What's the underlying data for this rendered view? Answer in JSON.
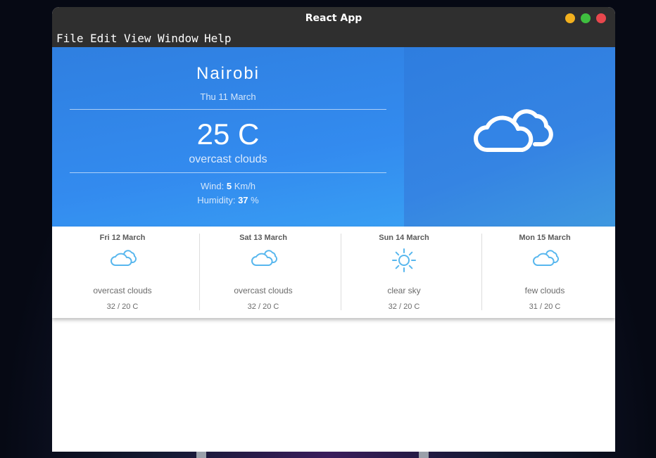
{
  "window": {
    "title": "React App"
  },
  "menu": [
    "File",
    "Edit",
    "View",
    "Window",
    "Help"
  ],
  "current": {
    "city": "Nairobi",
    "date": "Thu 11 March",
    "temp": "25 C",
    "description": "overcast clouds",
    "wind_label": "Wind:",
    "wind_value": "5",
    "wind_unit": "Km/h",
    "humidity_label": "Humidity:",
    "humidity_value": "37",
    "humidity_unit": "%",
    "icon": "cloud-icon"
  },
  "forecast": [
    {
      "day": "Fri 12 March",
      "icon": "cloud-icon",
      "description": "overcast clouds",
      "range": "32 / 20 C"
    },
    {
      "day": "Sat 13 March",
      "icon": "cloud-icon",
      "description": "overcast clouds",
      "range": "32 / 20 C"
    },
    {
      "day": "Sun 14 March",
      "icon": "sun-icon",
      "description": "clear sky",
      "range": "32 / 20 C"
    },
    {
      "day": "Mon 15 March",
      "icon": "cloud-icon",
      "description": "few clouds",
      "range": "31 / 20 C"
    }
  ],
  "colors": {
    "accent": "#338bef",
    "icon_blue": "#58b7ee",
    "titlebar": "#2f2f2f"
  }
}
